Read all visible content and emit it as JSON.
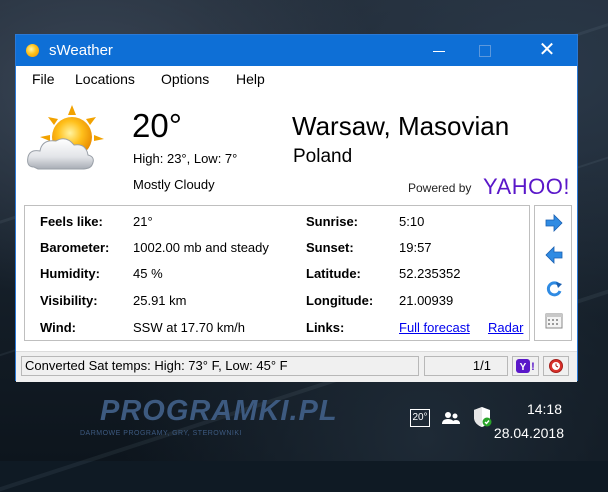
{
  "window": {
    "title": "sWeather",
    "close": "✕"
  },
  "menu": [
    "File",
    "Locations",
    "Options",
    "Help"
  ],
  "weather": {
    "temperature": "20°",
    "high_low": "High: 23°, Low: 7°",
    "condition": "Mostly Cloudy",
    "icon": "partly-cloudy-icon"
  },
  "location": {
    "city": "Warsaw, Masovian",
    "country": "Poland"
  },
  "powered_by": {
    "label": "Powered by",
    "brand": "YAHOO!",
    "brand_color": "#5a17c9"
  },
  "details": {
    "feels_like": {
      "label": "Feels like:",
      "value": "21°"
    },
    "barometer": {
      "label": "Barometer:",
      "value": "1002.00 mb and steady"
    },
    "humidity": {
      "label": "Humidity:",
      "value": "45 %"
    },
    "visibility": {
      "label": "Visibility:",
      "value": "25.91 km"
    },
    "wind": {
      "label": "Wind:",
      "value": "SSW at 17.70 km/h"
    },
    "sunrise": {
      "label": "Sunrise:",
      "value": "5:10"
    },
    "sunset": {
      "label": "Sunset:",
      "value": "19:57"
    },
    "latitude": {
      "label": "Latitude:",
      "value": "52.235352"
    },
    "longitude": {
      "label": "Longitude:",
      "value": "21.00939"
    },
    "links": {
      "label": "Links:",
      "full_forecast": "Full forecast",
      "radar": "Radar"
    }
  },
  "side_buttons": [
    "arrow-right-icon",
    "arrow-left-icon",
    "refresh-icon",
    "calendar-icon"
  ],
  "status": {
    "text": "Converted Sat temps: High: 73° F, Low: 45° F",
    "page": "1/1"
  },
  "taskbar": {
    "logo": "PROGRAMKI.PL",
    "logo_sub": "DARMOWE PROGRAMY, GRY, STEROWNIKI",
    "tray_temp": "20°",
    "time": "14:18",
    "date": "28.04.2018"
  },
  "colors": {
    "titlebar": "#0e6fd6",
    "link": "#0000ee",
    "yahoo": "#5a17c9",
    "arrow": "#2f8be3"
  }
}
